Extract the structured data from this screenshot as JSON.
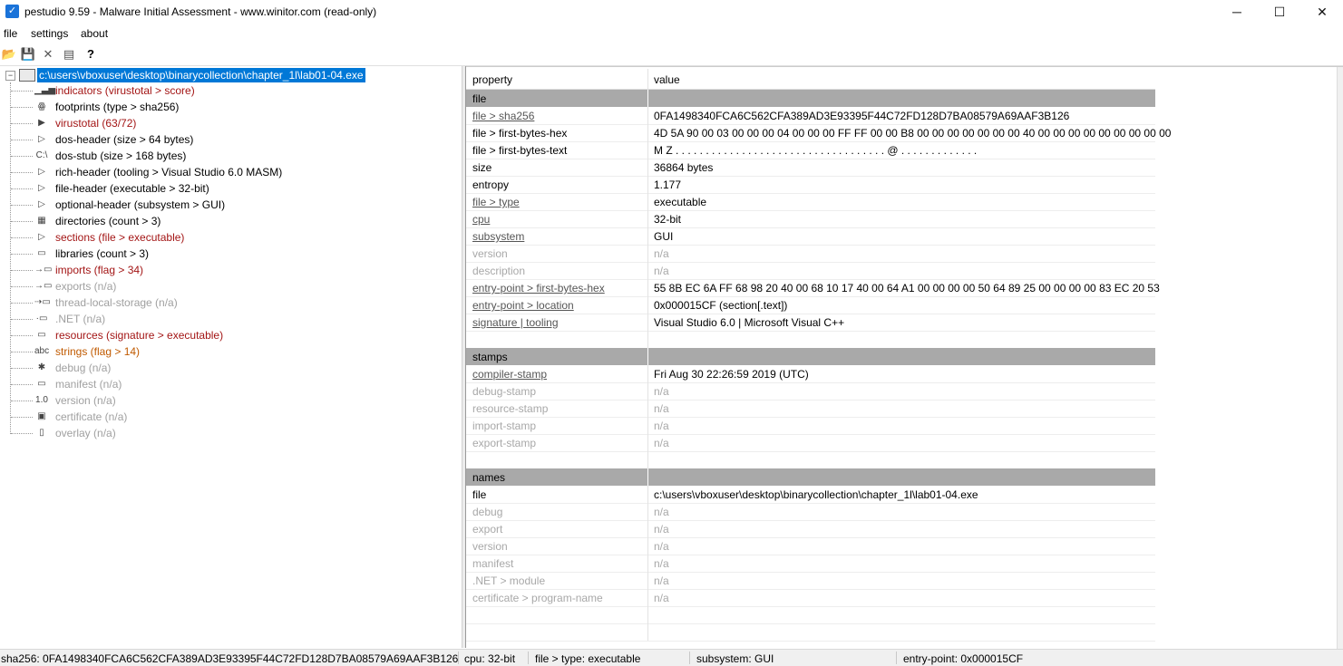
{
  "window": {
    "title": "pestudio 9.59 - Malware Initial Assessment - www.winitor.com (read-only)",
    "app_icon": "checkmark-icon",
    "controls": {
      "minimize": "─",
      "maximize": "☐",
      "close": "✕"
    }
  },
  "menu": {
    "file": "file",
    "settings": "settings",
    "about": "about"
  },
  "toolbar": {
    "open": "📂",
    "save": "💾",
    "delete": "✕",
    "list": "▤",
    "help": "?"
  },
  "tree": {
    "root": "c:\\users\\vboxuser\\desktop\\binarycollection\\chapter_1l\\lab01-04.exe",
    "items": [
      {
        "label": "indicators (virustotal > score)",
        "icon": "bar-chart-icon",
        "glyph": "▁▃▅",
        "color": "red"
      },
      {
        "label": "footprints (type > sha256)",
        "icon": "footprint-icon",
        "glyph": "ꙮ",
        "color": "black"
      },
      {
        "label": "virustotal (63/72)",
        "icon": "virustotal-icon",
        "glyph": "▶",
        "color": "red"
      },
      {
        "label": "dos-header (size > 64 bytes)",
        "icon": "arrow-right-icon",
        "glyph": "▷",
        "color": "black"
      },
      {
        "label": "dos-stub (size > 168 bytes)",
        "icon": "console-icon",
        "glyph": "C:\\",
        "color": "black"
      },
      {
        "label": "rich-header (tooling > Visual Studio 6.0 MASM)",
        "icon": "arrow-right-icon",
        "glyph": "▷",
        "color": "black"
      },
      {
        "label": "file-header (executable > 32-bit)",
        "icon": "arrow-right-icon",
        "glyph": "▷",
        "color": "black"
      },
      {
        "label": "optional-header (subsystem > GUI)",
        "icon": "arrow-right-icon",
        "glyph": "▷",
        "color": "black"
      },
      {
        "label": "directories (count > 3)",
        "icon": "directory-grid-icon",
        "glyph": "▦",
        "color": "black"
      },
      {
        "label": "sections (file > executable)",
        "icon": "arrow-right-icon",
        "glyph": "▷",
        "color": "red"
      },
      {
        "label": "libraries (count > 3)",
        "icon": "document-icon",
        "glyph": "▭",
        "color": "black"
      },
      {
        "label": "imports (flag > 34)",
        "icon": "import-icon",
        "glyph": "→▭",
        "color": "red"
      },
      {
        "label": "exports (n/a)",
        "icon": "export-icon",
        "glyph": "→▭",
        "color": "gray"
      },
      {
        "label": "thread-local-storage (n/a)",
        "icon": "thread-icon",
        "glyph": "⇢▭",
        "color": "gray"
      },
      {
        "label": ".NET (n/a)",
        "icon": "dotnet-icon",
        "glyph": "·▭",
        "color": "gray"
      },
      {
        "label": "resources (signature > executable)",
        "icon": "resources-icon",
        "glyph": "▭",
        "color": "red"
      },
      {
        "label": "strings (flag > 14)",
        "icon": "strings-icon",
        "glyph": "abc",
        "color": "orange"
      },
      {
        "label": "debug (n/a)",
        "icon": "bug-icon",
        "glyph": "✱",
        "color": "gray"
      },
      {
        "label": "manifest (n/a)",
        "icon": "manifest-icon",
        "glyph": "▭",
        "color": "gray"
      },
      {
        "label": "version (n/a)",
        "icon": "version-icon",
        "glyph": "1.0",
        "color": "gray"
      },
      {
        "label": "certificate (n/a)",
        "icon": "certificate-icon",
        "glyph": "▣",
        "color": "gray"
      },
      {
        "label": "overlay (n/a)",
        "icon": "overlay-icon",
        "glyph": "▯",
        "color": "gray"
      }
    ]
  },
  "table": {
    "headers": {
      "property": "property",
      "value": "value"
    },
    "rows": [
      {
        "type": "section",
        "property": "file",
        "value": ""
      },
      {
        "property": "file > sha256",
        "value": "0FA1498340FCA6C562CFA389AD3E93395F44C72FD128D7BA08579A69AAF3B126",
        "link": true
      },
      {
        "property": "file > first-bytes-hex",
        "value": "4D 5A 90 00 03 00 00 00 04 00 00 00 FF FF 00 00 B8 00 00 00 00 00 00 00 40 00 00 00 00 00 00 00 00 00"
      },
      {
        "property": "file > first-bytes-text",
        "value": "M Z . . . . . . . . . . . . . . . . . . . . . . . . . . . . . . . . . . . @ . . . . . . . . . . . . ."
      },
      {
        "property": "size",
        "value": "36864 bytes"
      },
      {
        "property": "entropy",
        "value": "1.177"
      },
      {
        "property": "file > type",
        "value": "executable",
        "link": true
      },
      {
        "property": "cpu",
        "value": "32-bit",
        "link": true
      },
      {
        "property": "subsystem",
        "value": "GUI",
        "link": true
      },
      {
        "property": "version",
        "value": "n/a",
        "muted": true
      },
      {
        "property": "description",
        "value": "n/a",
        "muted": true
      },
      {
        "property": "entry-point > first-bytes-hex",
        "value": "55 8B EC 6A FF 68 98 20 40 00 68 10 17 40 00 64 A1 00 00 00 00 50 64 89 25 00 00 00 00 83 EC 20 53",
        "link": true
      },
      {
        "property": "entry-point > location",
        "value": "0x000015CF (section[.text])",
        "link": true
      },
      {
        "property": "signature | tooling",
        "value": "Visual Studio 6.0 | Microsoft Visual C++",
        "link": true
      },
      {
        "type": "blank",
        "property": "",
        "value": ""
      },
      {
        "type": "section",
        "property": "stamps",
        "value": ""
      },
      {
        "property": "compiler-stamp",
        "value": "Fri Aug 30 22:26:59 2019 (UTC)",
        "link": true
      },
      {
        "property": "debug-stamp",
        "value": "n/a",
        "muted": true
      },
      {
        "property": "resource-stamp",
        "value": "n/a",
        "muted": true
      },
      {
        "property": "import-stamp",
        "value": "n/a",
        "muted": true
      },
      {
        "property": "export-stamp",
        "value": "n/a",
        "muted": true
      },
      {
        "type": "blank",
        "property": "",
        "value": ""
      },
      {
        "type": "section",
        "property": "names",
        "value": ""
      },
      {
        "property": "file",
        "value": "c:\\users\\vboxuser\\desktop\\binarycollection\\chapter_1l\\lab01-04.exe"
      },
      {
        "property": "debug",
        "value": "n/a",
        "muted": true
      },
      {
        "property": "export",
        "value": "n/a",
        "muted": true
      },
      {
        "property": "version",
        "value": "n/a",
        "muted": true
      },
      {
        "property": "manifest",
        "value": "n/a",
        "muted": true
      },
      {
        "property": ".NET > module",
        "value": "n/a",
        "muted": true
      },
      {
        "property": "certificate > program-name",
        "value": "n/a",
        "muted": true
      },
      {
        "type": "blank",
        "property": "",
        "value": ""
      },
      {
        "type": "blank",
        "property": "",
        "value": ""
      }
    ]
  },
  "status": {
    "sha256": "sha256: 0FA1498340FCA6C562CFA389AD3E93395F44C72FD128D7BA08579A69AAF3B126",
    "cpu": "cpu: 32-bit",
    "type": "file > type: executable",
    "subsystem": "subsystem: GUI",
    "entry_point": "entry-point: 0x000015CF"
  }
}
